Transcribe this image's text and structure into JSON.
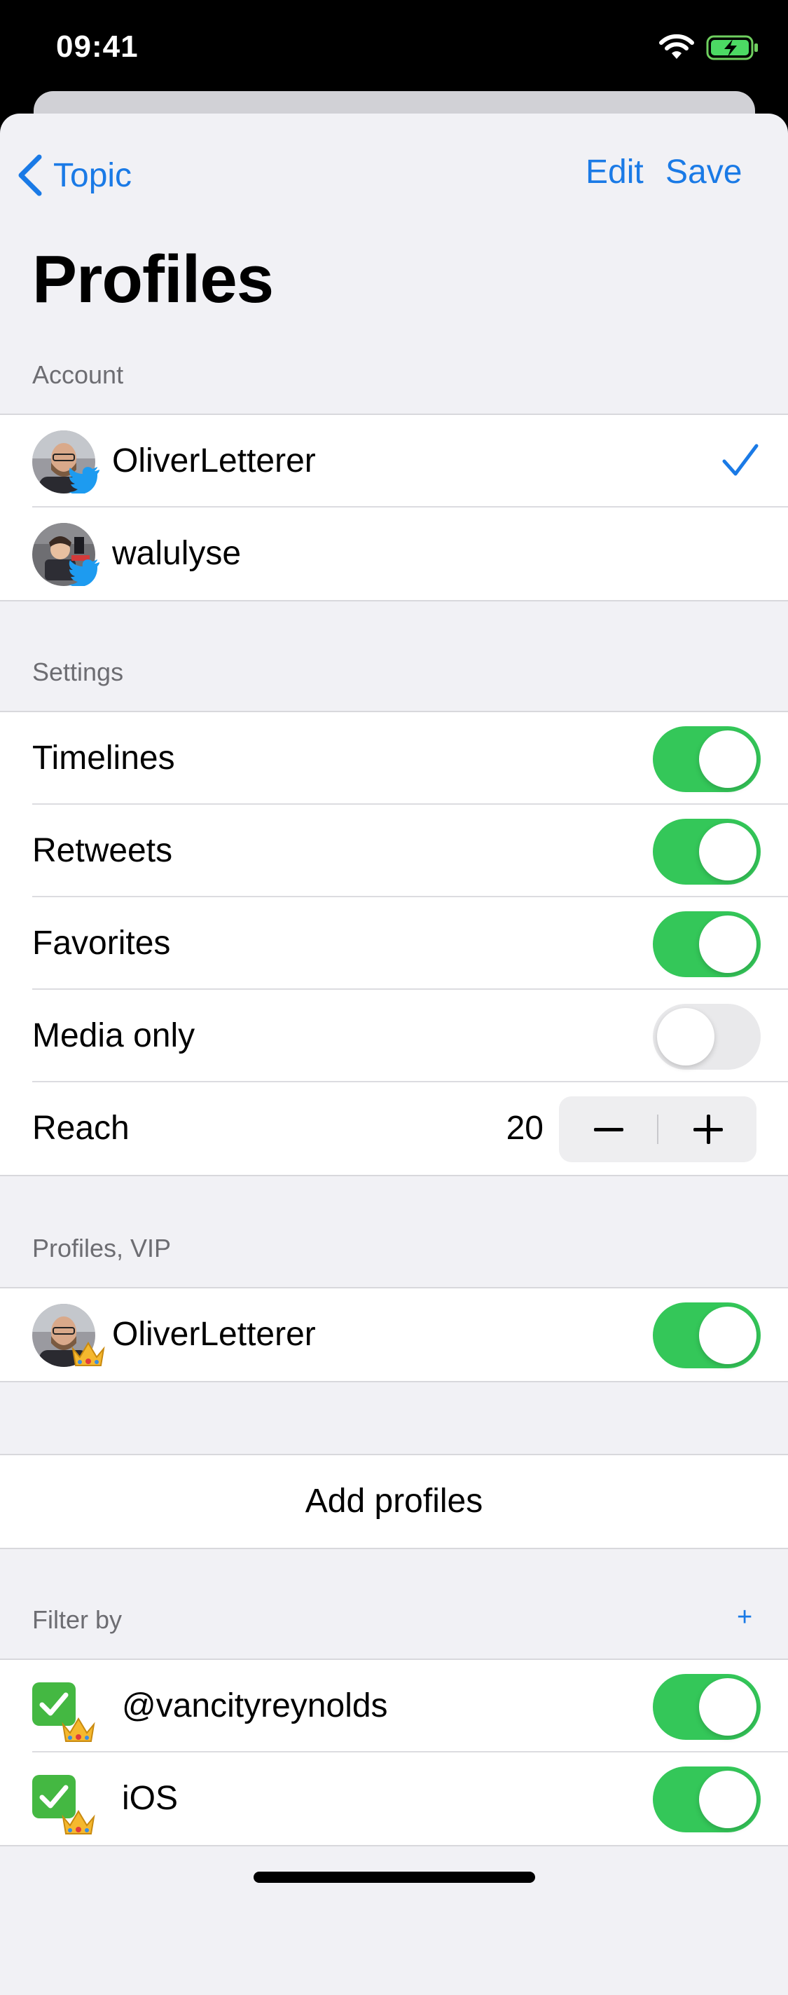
{
  "status_bar": {
    "time": "09:41"
  },
  "nav": {
    "back_label": "Topic",
    "edit_label": "Edit",
    "save_label": "Save"
  },
  "page": {
    "title": "Profiles"
  },
  "account": {
    "header": "Account",
    "items": [
      {
        "name": "OliverLetterer",
        "selected": true
      },
      {
        "name": "walulyse",
        "selected": false
      }
    ]
  },
  "settings": {
    "header": "Settings",
    "items": [
      {
        "label": "Timelines",
        "on": true
      },
      {
        "label": "Retweets",
        "on": true
      },
      {
        "label": "Favorites",
        "on": true
      },
      {
        "label": "Media only",
        "on": false
      }
    ],
    "reach": {
      "label": "Reach",
      "value": "20"
    }
  },
  "vip": {
    "header": "Profiles, VIP",
    "items": [
      {
        "name": "OliverLetterer",
        "on": true
      }
    ]
  },
  "add_profiles": {
    "label": "Add profiles"
  },
  "filter": {
    "header": "Filter by",
    "add_label": "+",
    "items": [
      {
        "label": "@vancityreynolds",
        "on": true
      },
      {
        "label": "iOS",
        "on": true
      }
    ]
  },
  "colors": {
    "accent": "#1a7ae6",
    "switch_on": "#34c759",
    "background": "#f1f1f5"
  }
}
